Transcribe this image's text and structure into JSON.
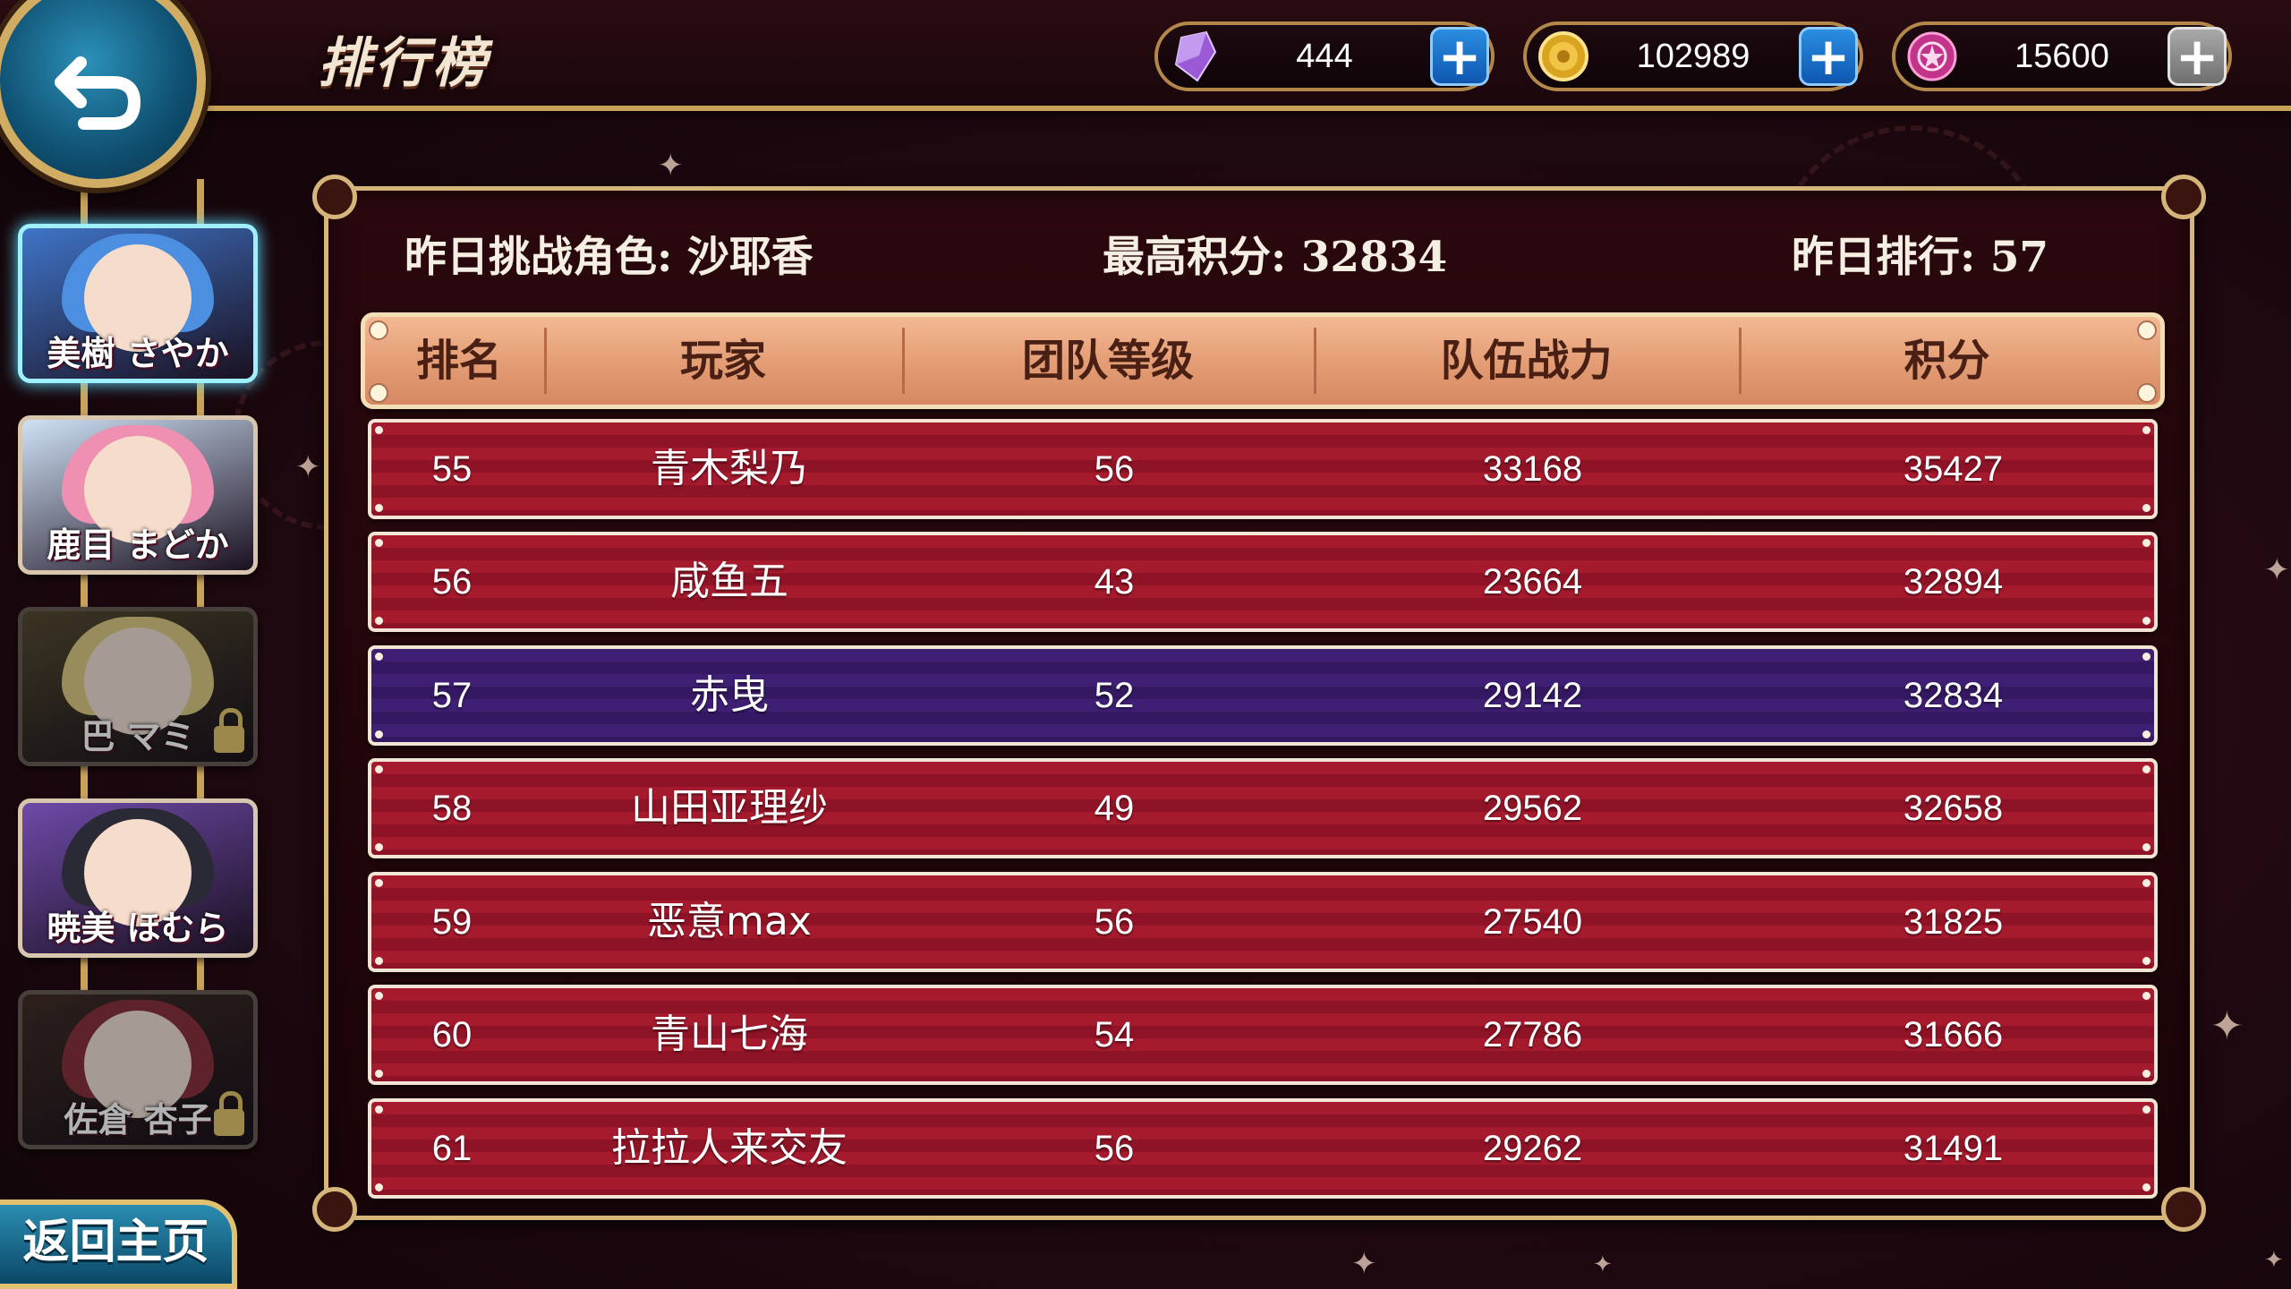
{
  "header": {
    "title": "排行榜",
    "currencies": [
      {
        "icon": "gem-icon",
        "value": "444",
        "button_color": "#1a73d6"
      },
      {
        "icon": "coin-icon",
        "value": "102989",
        "button_color": "#1a73d6"
      },
      {
        "icon": "magic-orb-icon",
        "value": "15600",
        "button_color": "#8c8c8c"
      }
    ]
  },
  "sidebar": {
    "characters": [
      {
        "name": "美樹 さやか",
        "locked": false,
        "active": true,
        "hair_color": "#4c8fe0",
        "bg_color": "#3f74c7"
      },
      {
        "name": "鹿目 まどか",
        "locked": false,
        "active": false,
        "hair_color": "#ef8fb2",
        "bg_color": "#cfe1f5"
      },
      {
        "name": "巴 マミ",
        "locked": true,
        "active": false,
        "hair_color": "#e6c85a",
        "bg_color": "#5b4a22"
      },
      {
        "name": "暁美 ほむら",
        "locked": false,
        "active": false,
        "hair_color": "#2a2a36",
        "bg_color": "#6e4aa8"
      },
      {
        "name": "佐倉 杏子",
        "locked": true,
        "active": false,
        "hair_color": "#b2243a",
        "bg_color": "#4a2a22"
      }
    ],
    "home_button": "返回主页"
  },
  "info": {
    "challenge_label": "昨日挑战角色: 沙耶香",
    "high_score_label": "最高积分: 32834",
    "rank_label": "昨日排行: 57"
  },
  "table": {
    "columns": [
      "排名",
      "玩家",
      "团队等级",
      "队伍战力",
      "积分"
    ],
    "rows": [
      {
        "rank": "55",
        "player": "青木梨乃",
        "level": "56",
        "power": "33168",
        "score": "35427",
        "highlight": false
      },
      {
        "rank": "56",
        "player": "咸鱼五",
        "level": "43",
        "power": "23664",
        "score": "32894",
        "highlight": false
      },
      {
        "rank": "57",
        "player": "赤曳",
        "level": "52",
        "power": "29142",
        "score": "32834",
        "highlight": true
      },
      {
        "rank": "58",
        "player": "山田亚理纱",
        "level": "49",
        "power": "29562",
        "score": "32658",
        "highlight": false
      },
      {
        "rank": "59",
        "player": "恶意max",
        "level": "56",
        "power": "27540",
        "score": "31825",
        "highlight": false
      },
      {
        "rank": "60",
        "player": "青山七海",
        "level": "54",
        "power": "27786",
        "score": "31666",
        "highlight": false
      },
      {
        "rank": "61",
        "player": "拉拉人来交友",
        "level": "56",
        "power": "29262",
        "score": "31491",
        "highlight": false
      }
    ]
  },
  "colors": {
    "accent_gold": "#d6b57a",
    "row_red": "#a51a2d",
    "row_highlight": "#3f1f74",
    "header_peach": "#e39c74"
  }
}
